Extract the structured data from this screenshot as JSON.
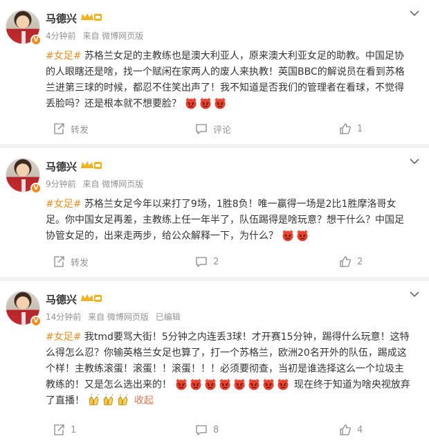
{
  "posts": [
    {
      "name": "马德兴",
      "time": "4分钟前",
      "source": "来自 微博网页版",
      "edited": "",
      "hashtag": "#女足#",
      "text": "苏格兰女足的主教练也是澳大利亚人，原来澳大利亚女足的助教。中国足协的人眼瞎还是啥，找一个赋闲在家两人的废人来执教！英国BBC的解说员在看到苏格兰进第三球的时候，都忍不住笑出声了！我不知道是否我们的管理者在看球，不觉得丢脸吗？还是根本就不想要脸？",
      "emoji_count": 3,
      "trailing_text": "",
      "collapse": "",
      "share_label": "转发",
      "comment_label": "评论",
      "like_count": "1"
    },
    {
      "name": "马德兴",
      "time": "9分钟前",
      "source": "来自 微博网页版",
      "edited": "",
      "hashtag": "#女足#",
      "text": "苏格兰女足今年以来打了9场，1胜8负！唯一赢得一场是2比1胜摩洛哥女足。你中国女足再差，主教练上任一年半了，队伍踢得是啥玩意？想干什么？中国足协管女足的，出来走两步，给公众解释一下，为什么？",
      "emoji_count": 2,
      "trailing_text": "",
      "collapse": "",
      "share_label": "转发",
      "comment_label": "2",
      "like_count": "2"
    },
    {
      "name": "马德兴",
      "time": "14分钟前",
      "source": "来自 微博网页版",
      "edited": "已编辑",
      "hashtag": "#女足#",
      "text": "我tmd要骂大街！5分钟之内连丢3球！才开赛15分钟，踢得什么玩意！这特么得怎么忍？你输英格兰女足也算了，打一个苏格兰，欧洲20名开外的队伍，踢成这个样！主教练滚蛋！滚蛋！！滚蛋！！！必须要彻查，当初是谁选择这么一个垃圾主教练的！又是怎么选出来的！",
      "emoji_count": 8,
      "trailing_text": "现在终于知道为啥央视放弃了直播！",
      "collapse": "收起",
      "share_label": "1",
      "comment_label": "8",
      "like_count": "4"
    }
  ],
  "colors": {
    "hashtag": "#f18c1f",
    "meta": "#939393",
    "badge": "#f18c1f",
    "collapse": "#eb7350"
  },
  "icons": {
    "more": "chevron-down-icon",
    "share": "share-icon",
    "comment": "comment-icon",
    "like": "thumbs-up-icon",
    "angry": "angry-face-emoji",
    "applause": "clapping-emoji",
    "crown": "vip-crown-icon",
    "verified": "verified-v-icon"
  }
}
